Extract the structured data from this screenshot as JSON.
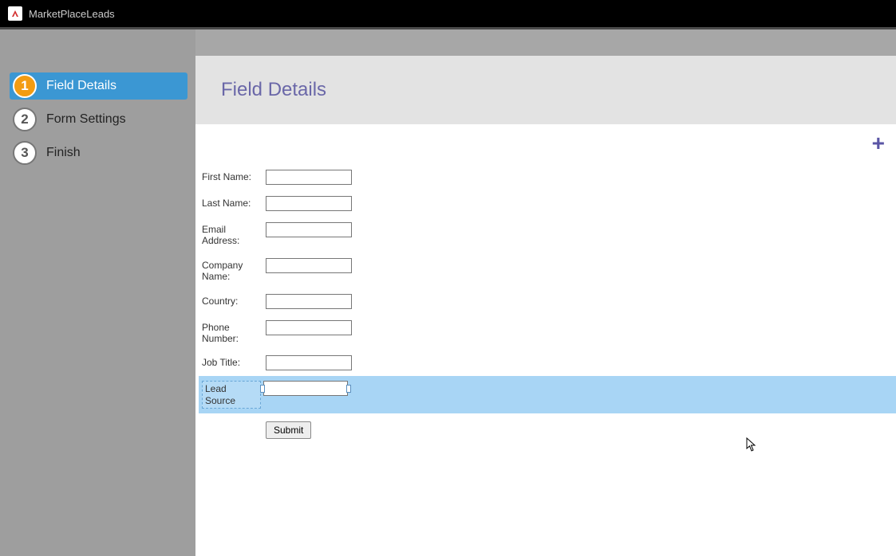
{
  "titlebar": {
    "app_name": "MarketPlaceLeads"
  },
  "sidebar": {
    "steps": [
      {
        "num": "1",
        "label": "Field Details",
        "active": true
      },
      {
        "num": "2",
        "label": "Form Settings",
        "active": false
      },
      {
        "num": "3",
        "label": "Finish",
        "active": false
      }
    ]
  },
  "header": {
    "title": "Field Details"
  },
  "add_icon_glyph": "+",
  "form": {
    "fields": [
      {
        "label": "First Name:",
        "value": "",
        "selected": false
      },
      {
        "label": "Last Name:",
        "value": "",
        "selected": false
      },
      {
        "label": "Email Address:",
        "value": "",
        "selected": false
      },
      {
        "label": "Company Name:",
        "value": "",
        "selected": false
      },
      {
        "label": "Country:",
        "value": "",
        "selected": false
      },
      {
        "label": "Phone Number:",
        "value": "",
        "selected": false
      },
      {
        "label": "Job Title:",
        "value": "",
        "selected": false
      },
      {
        "label": "Lead Source",
        "value": "",
        "selected": true
      }
    ],
    "submit_label": "Submit"
  }
}
